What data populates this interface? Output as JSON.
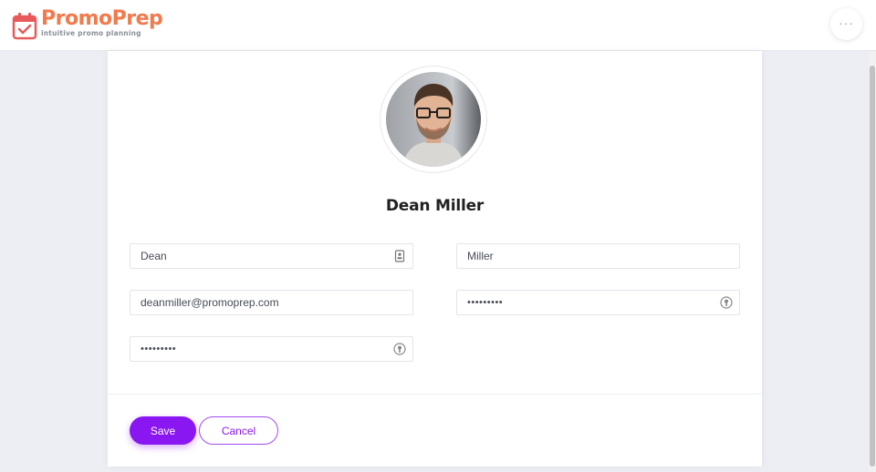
{
  "app": {
    "brand_name": "PromoPrep",
    "tagline": "intuitive promo planning",
    "brand_color": "#f27a4d",
    "more_icon": "ellipsis-icon",
    "more_label": "···"
  },
  "profile": {
    "full_name": "Dean Miller",
    "avatar_icon": "user-avatar-photo",
    "first_name": "Dean",
    "last_name": "Miller",
    "email": "deanmiller@promoprep.com",
    "password": "•••••••••",
    "confirm_password": "•••••••••"
  },
  "actions": {
    "save_label": "Save",
    "cancel_label": "Cancel",
    "accent_color": "#8a16f2"
  }
}
